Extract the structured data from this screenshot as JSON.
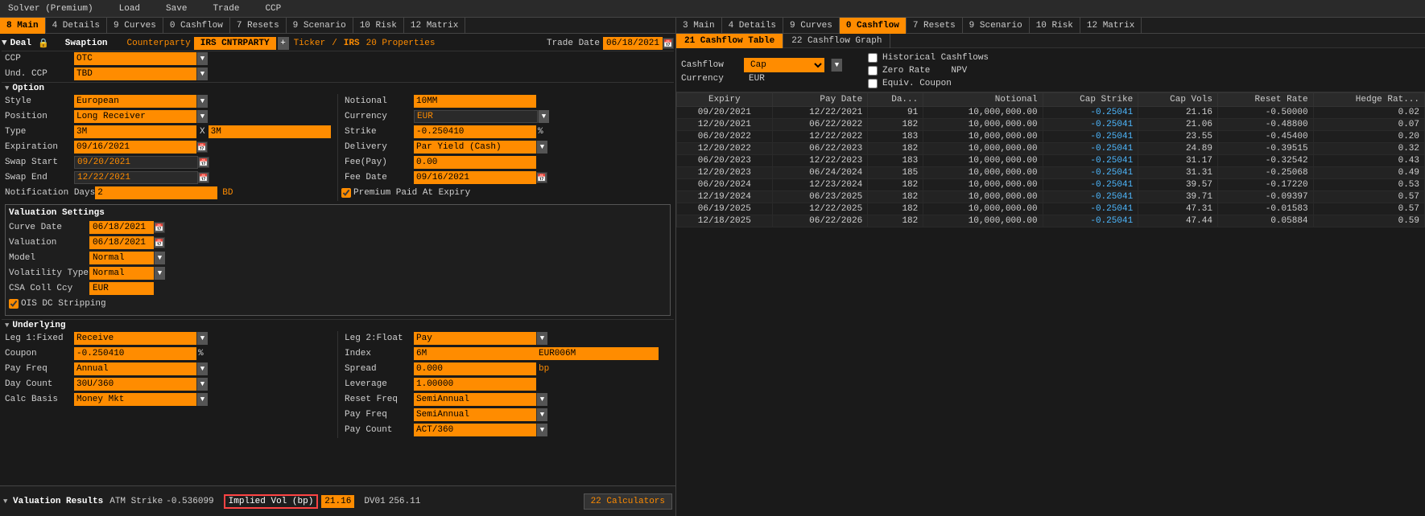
{
  "topbar": {
    "solver": "Solver (Premium)",
    "load": "Load",
    "save": "Save",
    "trade": "Trade",
    "ccp": "CCP"
  },
  "left_tabs": [
    {
      "id": "main",
      "label": "8 Main",
      "active": true
    },
    {
      "id": "details",
      "label": "4 Details"
    },
    {
      "id": "curves",
      "label": "9 Curves"
    },
    {
      "id": "cashflow",
      "label": "0 Cashflow"
    },
    {
      "id": "resets",
      "label": "7 Resets"
    },
    {
      "id": "scenario",
      "label": "9 Scenario"
    },
    {
      "id": "risk",
      "label": "10 Risk"
    },
    {
      "id": "matrix",
      "label": "12 Matrix"
    }
  ],
  "right_tabs": [
    {
      "id": "main",
      "label": "3 Main"
    },
    {
      "id": "details",
      "label": "4 Details"
    },
    {
      "id": "curves",
      "label": "9 Curves"
    },
    {
      "id": "cashflow",
      "label": "0 Cashflow",
      "active": true
    },
    {
      "id": "resets",
      "label": "7 Resets"
    },
    {
      "id": "scenario",
      "label": "9 Scenario"
    },
    {
      "id": "risk",
      "label": "10 Risk"
    },
    {
      "id": "matrix",
      "label": "12 Matrix"
    }
  ],
  "deal": {
    "section": "Deal",
    "type": "Swaption",
    "counterparty_label": "Counterparty",
    "counterparty_value": "IRS CNTRPARTY",
    "plus": "+",
    "ticker_label": "Ticker",
    "ticker_slash": "/",
    "ticker_value": "IRS",
    "properties": "20 Properties",
    "ccp_label": "CCP",
    "ccp_value": "OTC",
    "und_ccp_label": "Und. CCP",
    "und_ccp_value": "TBD",
    "trade_date_label": "Trade Date",
    "trade_date_value": "06/18/2021"
  },
  "option": {
    "section": "Option",
    "style_label": "Style",
    "style_value": "European",
    "notional_label": "Notional",
    "notional_value": "10MM",
    "position_label": "Position",
    "position_value": "Long Receiver",
    "currency_label": "Currency",
    "currency_value": "EUR",
    "type_label": "Type",
    "type_left": "3M",
    "type_x": "X",
    "type_right": "3M",
    "strike_label": "Strike",
    "strike_value": "-0.250410",
    "strike_pct": "%",
    "expiration_label": "Expiration",
    "expiration_value": "09/16/2021",
    "delivery_label": "Delivery",
    "delivery_value": "Par Yield (Cash)",
    "swap_start_label": "Swap Start",
    "swap_start_value": "09/20/2021",
    "fee_pay_label": "Fee(Pay)",
    "fee_pay_value": "0.00",
    "swap_end_label": "Swap End",
    "swap_end_value": "12/22/2021",
    "fee_date_label": "Fee Date",
    "fee_date_value": "09/16/2021",
    "notification_label": "Notification Days",
    "notification_value": "2",
    "notification_bd": "BD",
    "premium_label": "Premium Paid At Expiry"
  },
  "valuation": {
    "title": "Valuation Settings",
    "curve_date_label": "Curve Date",
    "curve_date_value": "06/18/2021",
    "valuation_label": "Valuation",
    "valuation_value": "06/18/2021",
    "model_label": "Model",
    "model_value": "Normal",
    "vol_type_label": "Volatility Type",
    "vol_type_value": "Normal",
    "csa_label": "CSA Coll Ccy",
    "csa_value": "EUR",
    "ois_label": "OIS DC Stripping"
  },
  "underlying": {
    "section": "Underlying",
    "leg1_label": "Leg 1:Fixed",
    "leg1_value": "Receive",
    "leg2_label": "Leg 2:Float",
    "leg2_value": "Pay",
    "coupon_label": "Coupon",
    "coupon_value": "-0.250410",
    "coupon_pct": "%",
    "index_label": "Index",
    "index_left": "6M",
    "index_right": "EUR006M",
    "pay_freq_label": "Pay Freq",
    "pay_freq_value": "Annual",
    "spread_label": "Spread",
    "spread_value": "0.000",
    "spread_bp": "bp",
    "day_count_label": "Day Count",
    "day_count_value": "30U/360",
    "leverage_label": "Leverage",
    "leverage_value": "1.00000",
    "calc_basis_label": "Calc Basis",
    "calc_basis_value": "Money Mkt",
    "reset_freq_label": "Reset Freq",
    "reset_freq_value": "SemiAnnual",
    "pay_freq2_label": "Pay Freq",
    "pay_freq2_value": "SemiAnnual",
    "day_count2_label": "Pay Count",
    "day_count2_value": "ACT/360"
  },
  "results": {
    "section": "Valuation Results",
    "atm_label": "ATM Strike",
    "atm_value": "-0.536099",
    "implied_label": "Implied Vol (bp)",
    "implied_value": "21.16",
    "dv01_label": "DV01",
    "dv01_value": "256.11",
    "calculators": "22 Calculators"
  },
  "cashflow": {
    "subtabs": [
      {
        "label": "21 Cashflow Table",
        "active": true
      },
      {
        "label": "22 Cashflow Graph"
      }
    ],
    "cashflow_label": "Cashflow",
    "cashflow_value": "Cap",
    "currency_label": "Currency",
    "currency_value": "EUR",
    "historical_label": "Historical Cashflows",
    "zero_rate_label": "Zero Rate",
    "npv_label": "NPV",
    "equiv_coupon_label": "Equiv. Coupon",
    "columns": [
      "Expiry",
      "Pay Date",
      "Da...",
      "Notional",
      "Cap Strike",
      "Cap Vols",
      "Reset Rate",
      "Hedge Rat..."
    ],
    "rows": [
      {
        "expiry": "09/20/2021",
        "pay_date": "12/22/2021",
        "da": "91",
        "notional": "10,000,000.00",
        "cap_strike": "-0.25041",
        "cap_vols": "21.16",
        "reset_rate": "-0.50000",
        "hedge_rate": "0.02"
      },
      {
        "expiry": "12/20/2021",
        "pay_date": "06/22/2022",
        "da": "182",
        "notional": "10,000,000.00",
        "cap_strike": "-0.25041",
        "cap_vols": "21.06",
        "reset_rate": "-0.48800",
        "hedge_rate": "0.07"
      },
      {
        "expiry": "06/20/2022",
        "pay_date": "12/22/2022",
        "da": "183",
        "notional": "10,000,000.00",
        "cap_strike": "-0.25041",
        "cap_vols": "23.55",
        "reset_rate": "-0.45400",
        "hedge_rate": "0.20"
      },
      {
        "expiry": "12/20/2022",
        "pay_date": "06/22/2023",
        "da": "182",
        "notional": "10,000,000.00",
        "cap_strike": "-0.25041",
        "cap_vols": "24.89",
        "reset_rate": "-0.39515",
        "hedge_rate": "0.32"
      },
      {
        "expiry": "06/20/2023",
        "pay_date": "12/22/2023",
        "da": "183",
        "notional": "10,000,000.00",
        "cap_strike": "-0.25041",
        "cap_vols": "31.17",
        "reset_rate": "-0.32542",
        "hedge_rate": "0.43"
      },
      {
        "expiry": "12/20/2023",
        "pay_date": "06/24/2024",
        "da": "185",
        "notional": "10,000,000.00",
        "cap_strike": "-0.25041",
        "cap_vols": "31.31",
        "reset_rate": "-0.25068",
        "hedge_rate": "0.49"
      },
      {
        "expiry": "06/20/2024",
        "pay_date": "12/23/2024",
        "da": "182",
        "notional": "10,000,000.00",
        "cap_strike": "-0.25041",
        "cap_vols": "39.57",
        "reset_rate": "-0.17220",
        "hedge_rate": "0.53"
      },
      {
        "expiry": "12/19/2024",
        "pay_date": "06/23/2025",
        "da": "182",
        "notional": "10,000,000.00",
        "cap_strike": "-0.25041",
        "cap_vols": "39.71",
        "reset_rate": "-0.09397",
        "hedge_rate": "0.57"
      },
      {
        "expiry": "06/19/2025",
        "pay_date": "12/22/2025",
        "da": "182",
        "notional": "10,000,000.00",
        "cap_strike": "-0.25041",
        "cap_vols": "47.31",
        "reset_rate": "-0.01583",
        "hedge_rate": "0.57"
      },
      {
        "expiry": "12/18/2025",
        "pay_date": "06/22/2026",
        "da": "182",
        "notional": "10,000,000.00",
        "cap_strike": "-0.25041",
        "cap_vols": "47.44",
        "reset_rate": "0.05884",
        "hedge_rate": "0.59"
      }
    ]
  }
}
